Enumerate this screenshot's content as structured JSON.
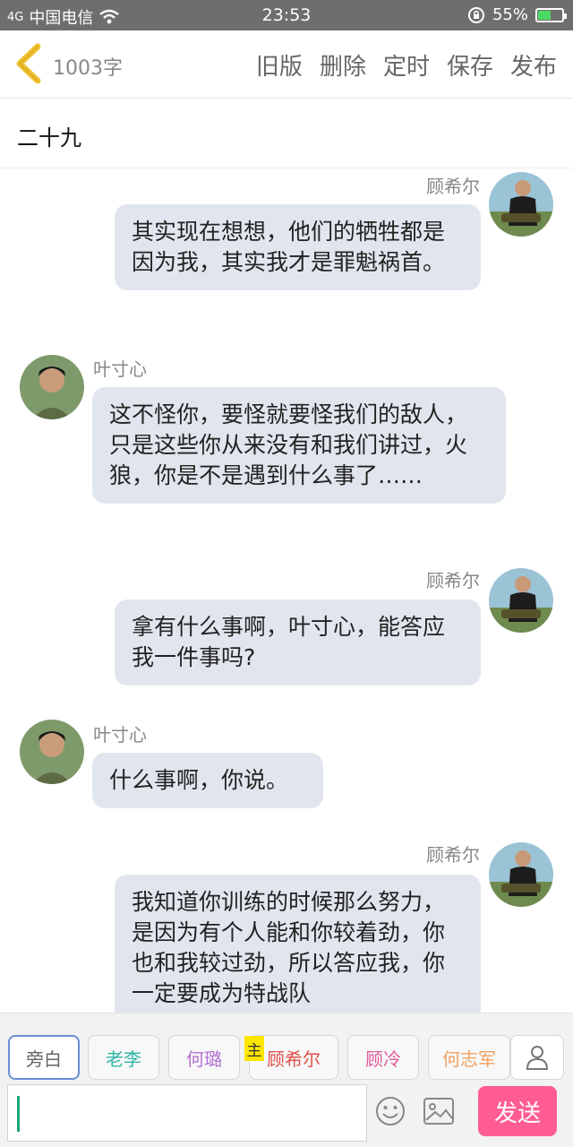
{
  "status_bar": {
    "signal": "4G",
    "carrier": "中国电信",
    "time": "23:53",
    "battery": "55%",
    "battery_level": 0.55
  },
  "header": {
    "word_count": "1003字",
    "actions": [
      "旧版",
      "删除",
      "定时",
      "保存",
      "发布"
    ]
  },
  "chapter_title": "二十九",
  "messages": [
    {
      "speaker": "顾希尔",
      "side": "right",
      "text": "其实现在想想，他们的牺牲都是因为我，其实我才是罪魁祸首。"
    },
    {
      "speaker": "叶寸心",
      "side": "left",
      "text": "这不怪你，要怪就要怪我们的敌人，只是这些你从来没有和我们讲过，火狼，你是不是遇到什么事了……"
    },
    {
      "speaker": "顾希尔",
      "side": "right",
      "text": "拿有什么事啊，叶寸心，能答应我一件事吗?"
    },
    {
      "speaker": "叶寸心",
      "side": "left",
      "text": "什么事啊，你说。"
    },
    {
      "speaker": "顾希尔",
      "side": "right",
      "text": "我知道你训练的时候那么努力，是因为有个人能和你较着劲，你也和我较过劲，所以答应我，你一定要成为特战队"
    }
  ],
  "roles": [
    {
      "label": "旁白",
      "color": "#666666",
      "selected": true
    },
    {
      "label": "老李",
      "color": "#2bb5a5"
    },
    {
      "label": "何璐",
      "color": "#b06fd0"
    },
    {
      "label": "顾希尔",
      "color": "#e0504a",
      "host": true
    },
    {
      "label": "顾冷",
      "color": "#e05a9a"
    },
    {
      "label": "何志军",
      "color": "#f0a060"
    }
  ],
  "host_badge": "主",
  "input": {
    "value": "",
    "send_label": "发送"
  },
  "colors": {
    "bubble": "#e1e6ee",
    "send": "#ff5c93",
    "back_icon": "#f2c230"
  },
  "icons": [
    "back-chevron-icon",
    "wifi-icon",
    "rotation-lock-icon",
    "battery-icon",
    "user-icon",
    "emoji-icon",
    "image-icon"
  ]
}
